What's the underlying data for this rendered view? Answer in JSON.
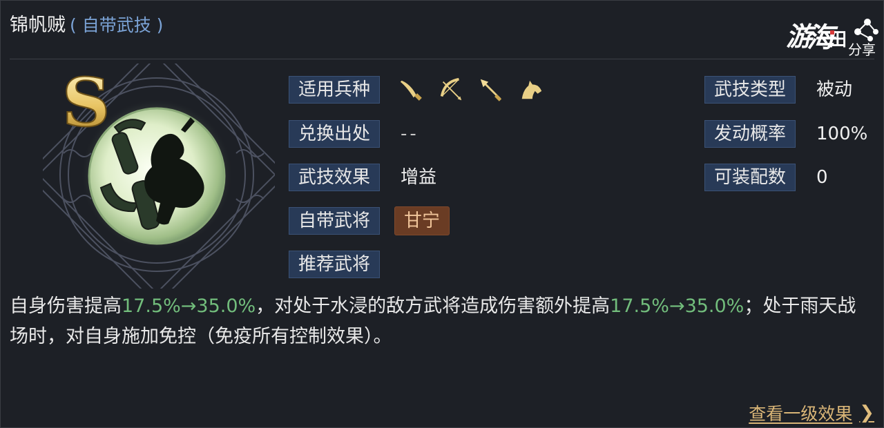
{
  "header": {
    "title": "锦帆贼",
    "subtitle": "( 自带武技 )"
  },
  "watermark": {
    "main": "游",
    "sub": "分享"
  },
  "skill": {
    "grade": "S",
    "icon": "anchor-warrior-emblem"
  },
  "fields_left": [
    {
      "label": "适用兵种",
      "value": ""
    },
    {
      "label": "兑换出处",
      "value": "--"
    },
    {
      "label": "武技效果",
      "value": "增益"
    },
    {
      "label": "自带武将",
      "value": "甘宁"
    },
    {
      "label": "推荐武将",
      "value": ""
    }
  ],
  "troop_types": [
    "sword-icon",
    "bow-icon",
    "spear-icon",
    "horse-icon"
  ],
  "fields_right": [
    {
      "label": "武技类型",
      "value": "被动"
    },
    {
      "label": "发动概率",
      "value": "100%"
    },
    {
      "label": "可装配数",
      "value": "0"
    }
  ],
  "description": {
    "part1": "自身伤害提高",
    "num1": "17.5%→35.0%",
    "part2": "，对处于水浸的敌方武将造成伤害额外提高",
    "num2": "17.5%→35.0%",
    "part3": "；处于雨天战场时，对自身施加免控（免疫所有控制效果）。"
  },
  "footer": {
    "link": "查看一级效果",
    "chevron": "❯"
  },
  "colors": {
    "background": "#1d2026",
    "label_bg": "#283a57",
    "subtitle": "#7ba3d6",
    "highlight_green": "#72bd7c",
    "badge_bg": "#6a3c24",
    "gold": "#d9b577"
  }
}
